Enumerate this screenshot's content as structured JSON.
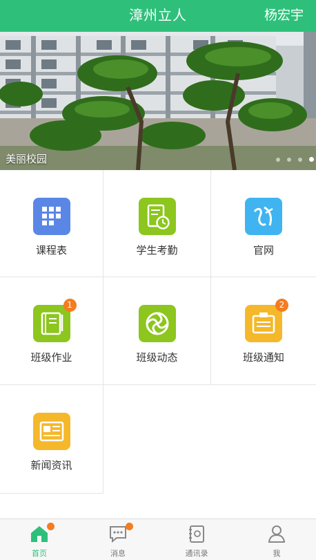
{
  "header": {
    "title": "漳州立人",
    "user": "杨宏宇"
  },
  "banner": {
    "caption": "美丽校园",
    "slide_index": 4,
    "slide_count": 4
  },
  "grid": [
    {
      "label": "课程表",
      "icon": "schedule-grid-icon",
      "color": "#5a87e6",
      "badge": ""
    },
    {
      "label": "学生考勤",
      "icon": "attendance-clock-icon",
      "color": "#8cc61e",
      "badge": ""
    },
    {
      "label": "官网",
      "icon": "website-logo-icon",
      "color": "#3fb4f0",
      "badge": ""
    },
    {
      "label": "班级作业",
      "icon": "homework-book-icon",
      "color": "#8cc61e",
      "badge": "1"
    },
    {
      "label": "班级动态",
      "icon": "class-moments-icon",
      "color": "#8cc61e",
      "badge": ""
    },
    {
      "label": "班级通知",
      "icon": "notice-board-icon",
      "color": "#f5b82a",
      "badge": "2"
    },
    {
      "label": "新闻资讯",
      "icon": "news-icon",
      "color": "#f5b82a",
      "badge": ""
    }
  ],
  "tabs": [
    {
      "label": "首页",
      "icon": "home-icon",
      "active": true,
      "dot": true
    },
    {
      "label": "消息",
      "icon": "message-icon",
      "active": false,
      "dot": true
    },
    {
      "label": "通讯录",
      "icon": "contacts-icon",
      "active": false,
      "dot": false
    },
    {
      "label": "我",
      "icon": "profile-icon",
      "active": false,
      "dot": false
    }
  ],
  "colors": {
    "brand": "#2ec07a",
    "badge": "#f57c1f"
  }
}
